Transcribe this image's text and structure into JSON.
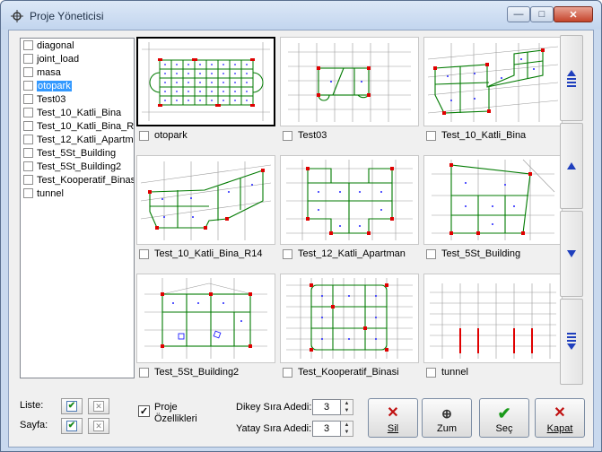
{
  "window": {
    "title": "Proje Yöneticisi",
    "controls": {
      "minimize": "—",
      "maximize": "□",
      "close": "✕"
    }
  },
  "project_list": {
    "items": [
      {
        "label": "diagonal",
        "selected": false
      },
      {
        "label": "joint_load",
        "selected": false
      },
      {
        "label": "masa",
        "selected": false
      },
      {
        "label": "otopark",
        "selected": true
      },
      {
        "label": "Test03",
        "selected": false
      },
      {
        "label": "Test_10_Katli_Bina",
        "selected": false
      },
      {
        "label": "Test_10_Katli_Bina_R14",
        "selected": false
      },
      {
        "label": "Test_12_Katli_Apartman",
        "selected": false
      },
      {
        "label": "Test_5St_Building",
        "selected": false
      },
      {
        "label": "Test_5St_Building2",
        "selected": false
      },
      {
        "label": "Test_Kooperatif_Binasi",
        "selected": false
      },
      {
        "label": "tunnel",
        "selected": false
      }
    ]
  },
  "thumbnails": [
    {
      "label": "otopark",
      "active": true
    },
    {
      "label": "Test03",
      "active": false
    },
    {
      "label": "Test_10_Katli_Bina",
      "active": false
    },
    {
      "label": "Test_10_Katli_Bina_R14",
      "active": false
    },
    {
      "label": "Test_12_Katli_Apartman",
      "active": false
    },
    {
      "label": "Test_5St_Building",
      "active": false
    },
    {
      "label": "Test_5St_Building2",
      "active": false
    },
    {
      "label": "Test_Kooperatif_Binasi",
      "active": false
    },
    {
      "label": "tunnel",
      "active": false
    }
  ],
  "scroll_buttons": {
    "top": "first-page-icon",
    "up": "page-up-icon",
    "down": "page-down-icon",
    "bottom": "last-page-icon"
  },
  "bottom": {
    "liste_label": "Liste:",
    "sayfa_label": "Sayfa:",
    "proje_ozellikleri_line1": "Proje",
    "proje_ozellikleri_line2": "Özellikleri",
    "proje_ozellikleri_checked": true,
    "dikey_label": "Dikey Sıra Adedi:",
    "dikey_value": "3",
    "yatay_label": "Yatay Sıra Adedi:",
    "yatay_value": "3",
    "buttons": {
      "sil": "Sil",
      "zum": "Zum",
      "sec": "Seç",
      "kapat": "Kapat"
    }
  },
  "colors": {
    "selection": "#3399ff",
    "wall_green": "#007a00",
    "column_red": "#e00000",
    "grid_gray": "#999999",
    "node_blue": "#2020ff"
  }
}
